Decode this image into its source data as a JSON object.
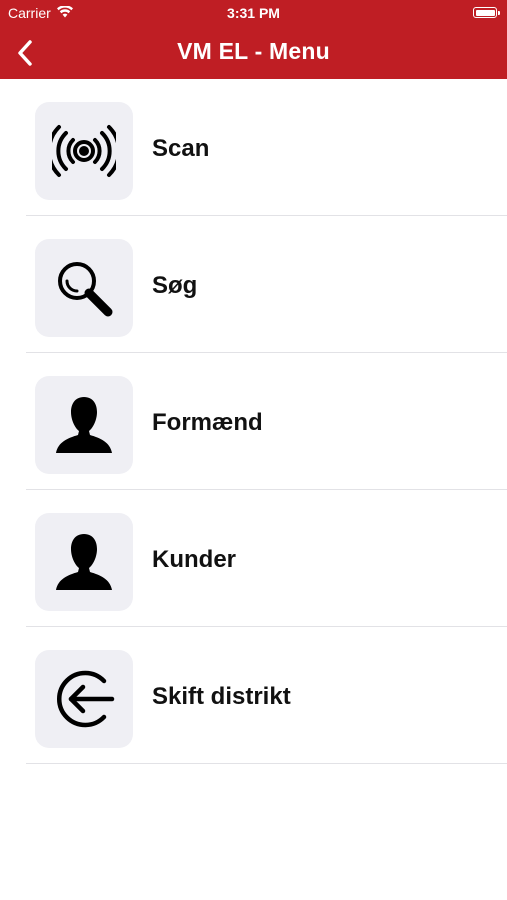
{
  "status_bar": {
    "carrier": "Carrier",
    "time": "3:31 PM",
    "wifi_icon": "wifi-icon",
    "battery_icon": "battery-icon"
  },
  "nav": {
    "title": "VM EL - Menu",
    "back_icon": "chevron-left-icon"
  },
  "colors": {
    "header": "#bf1e24",
    "tile": "#efeff4",
    "separator": "#e2e2e6",
    "icon": "#000000"
  },
  "menu": {
    "items": [
      {
        "label": "Scan",
        "icon": "scan-icon"
      },
      {
        "label": "Søg",
        "icon": "search-icon"
      },
      {
        "label": "Formænd",
        "icon": "person-icon"
      },
      {
        "label": "Kunder",
        "icon": "person-icon"
      },
      {
        "label": "Skift distrikt",
        "icon": "logout-icon"
      }
    ]
  }
}
